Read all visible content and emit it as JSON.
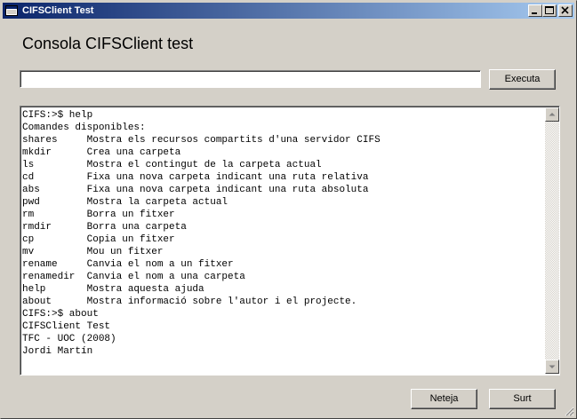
{
  "window": {
    "title": "CIFSClient Test",
    "controls": [
      "minimize",
      "maximize",
      "close"
    ]
  },
  "main": {
    "heading": "Consola CIFSClient test",
    "command_input": {
      "value": "",
      "placeholder": ""
    },
    "execute_label": "Executa",
    "output_lines": [
      "CIFS:>$ help",
      "Comandes disponibles:",
      "shares     Mostra els recursos compartits d'una servidor CIFS",
      "mkdir      Crea una carpeta",
      "ls         Mostra el contingut de la carpeta actual",
      "cd         Fixa una nova carpeta indicant una ruta relativa",
      "abs        Fixa una nova carpeta indicant una ruta absoluta",
      "pwd        Mostra la carpeta actual",
      "rm         Borra un fitxer",
      "rmdir      Borra una carpeta",
      "cp         Copia un fitxer",
      "mv         Mou un fitxer",
      "rename     Canvia el nom a un fitxer",
      "renamedir  Canvia el nom a una carpeta",
      "help       Mostra aquesta ajuda",
      "about      Mostra informació sobre l'autor i el projecte.",
      "CIFS:>$ about",
      "CIFSClient Test",
      "TFC - UOC (2008)",
      "Jordi Martín"
    ],
    "clear_label": "Neteja",
    "exit_label": "Surt"
  },
  "colors": {
    "titlebar_start": "#0a246a",
    "titlebar_end": "#a6caf0",
    "face": "#d4d0c8"
  }
}
